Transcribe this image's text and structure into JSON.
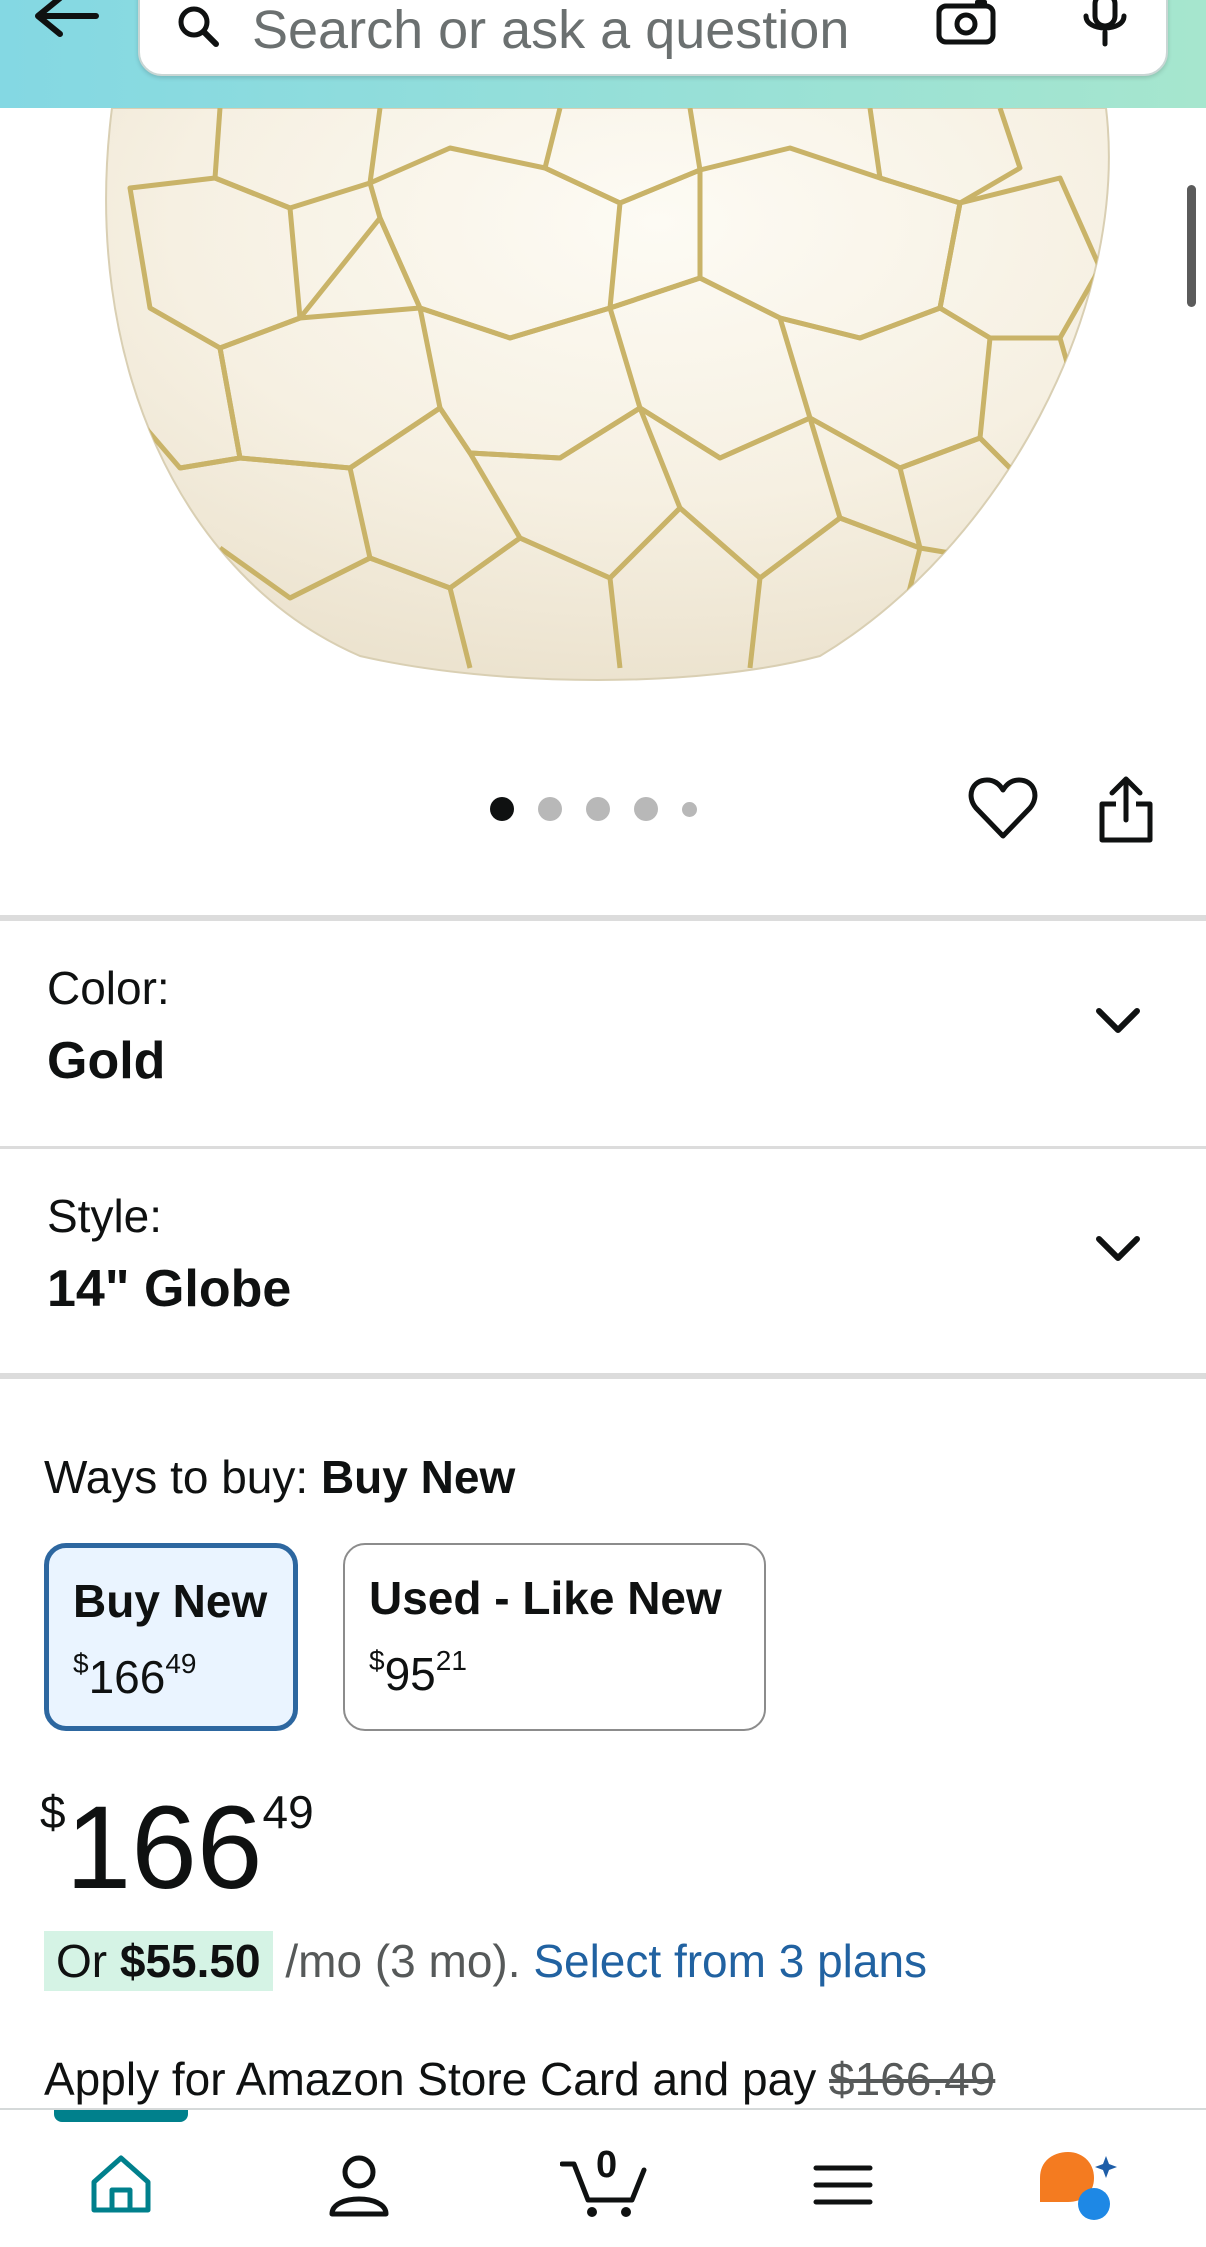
{
  "header": {
    "search_placeholder": "Search or ask a question"
  },
  "product": {
    "image_count": 5,
    "active_image_index": 0
  },
  "variations": [
    {
      "label": "Color:",
      "value": "Gold"
    },
    {
      "label": "Style:",
      "value": "14\" Globe"
    }
  ],
  "buying": {
    "ways_to_buy_label": "Ways to buy:",
    "ways_to_buy_selected": "Buy New",
    "options": [
      {
        "title": "Buy New",
        "currency": "$",
        "whole": "166",
        "fraction": "49",
        "selected": true
      },
      {
        "title": "Used - Like New",
        "currency": "$",
        "whole": "95",
        "fraction": "21",
        "selected": false
      }
    ]
  },
  "price": {
    "currency": "$",
    "whole": "166",
    "fraction": "49"
  },
  "installment": {
    "prefix": "Or ",
    "amount": "$55.50",
    "terms": " /mo (3 mo). ",
    "link": "Select from 3 plans"
  },
  "store_card": {
    "text": "Apply for Amazon Store Card and pay ",
    "strike_price": "$166.49"
  },
  "bottom_nav": {
    "cart_count": "0",
    "accent_color": "#00808c"
  },
  "colors": {
    "header_start": "#84d8e3",
    "header_end": "#a6e6ce",
    "selected_border": "#2d67a0",
    "link": "#2162a1",
    "installment_highlight": "#d5f3e5"
  }
}
